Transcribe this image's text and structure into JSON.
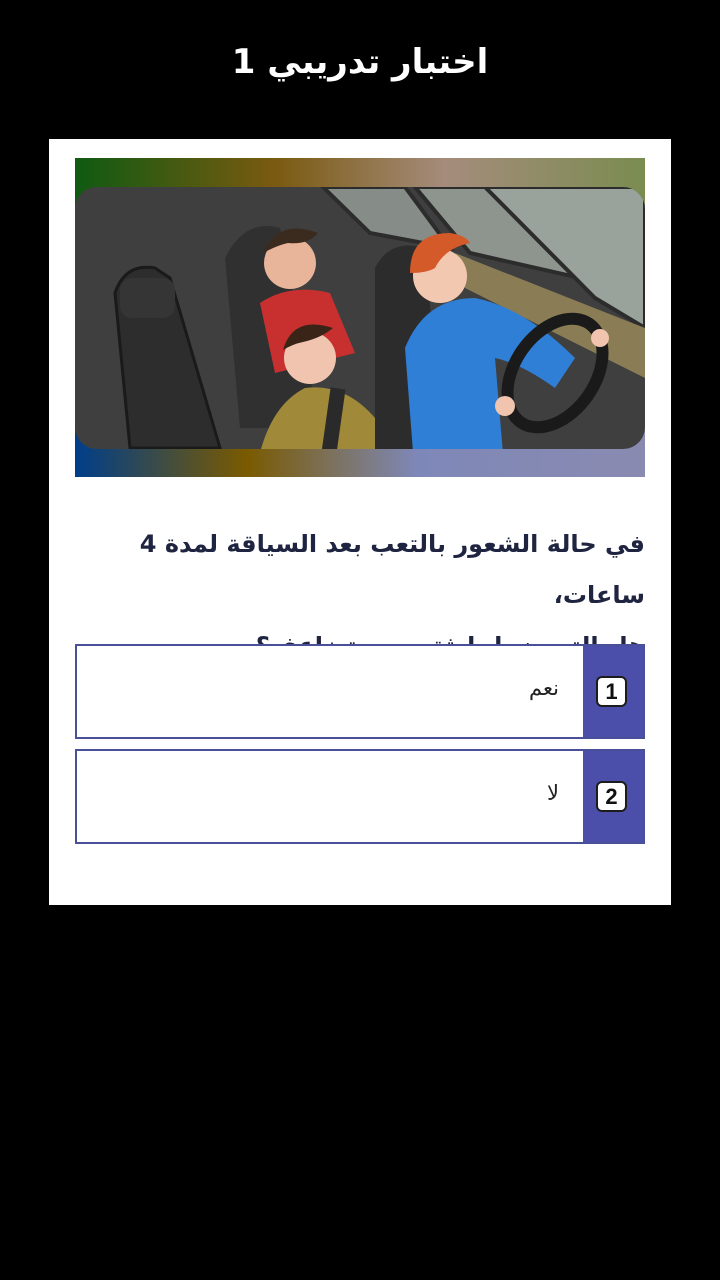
{
  "header": {
    "title": "اختبار تدريبي 1"
  },
  "question": {
    "line1": "في حالة الشعور بالتعب بعد السياقة لمدة 4 ساعات،",
    "line2": "هل التعرض لحادثة سير يتضاعف؟"
  },
  "options": [
    {
      "number": "1",
      "label": "نعم"
    },
    {
      "number": "2",
      "label": "لا"
    }
  ],
  "colors": {
    "background": "#000000",
    "card": "#ffffff",
    "accent": "#4b4faa",
    "question_text": "#1f2440"
  }
}
